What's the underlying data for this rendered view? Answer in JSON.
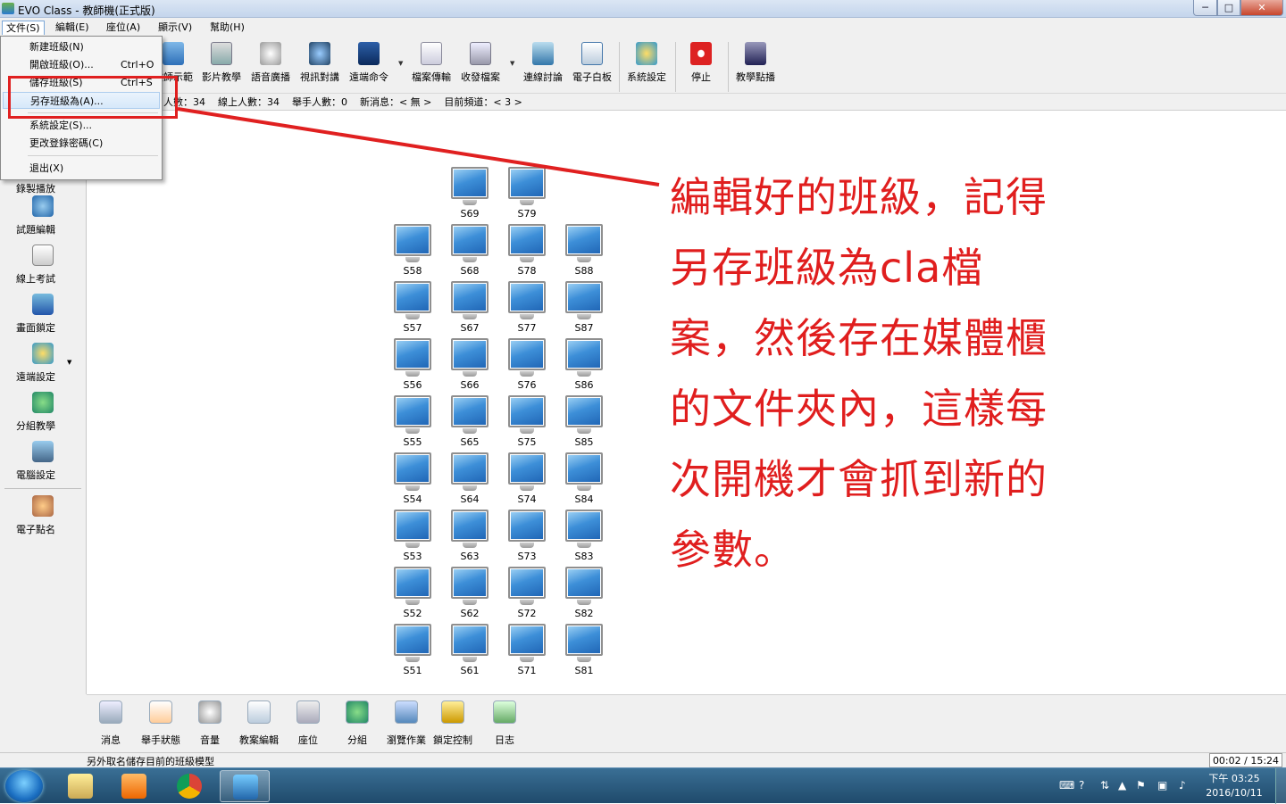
{
  "window": {
    "title": "EVO Class - 教師機(正式版)",
    "min_glyph": "─",
    "max_glyph": "□",
    "close_glyph": "✕"
  },
  "menubar": [
    {
      "label": "文件(S)"
    },
    {
      "label": "編輯(E)"
    },
    {
      "label": "座位(A)"
    },
    {
      "label": "顯示(V)"
    },
    {
      "label": "幫助(H)"
    }
  ],
  "file_menu": [
    {
      "label": "新建班級(N)",
      "shortcut": ""
    },
    {
      "label": "開啟班級(O)...",
      "shortcut": "Ctrl+O"
    },
    {
      "label": "儲存班級(S)",
      "shortcut": "Ctrl+S"
    },
    {
      "label": "另存班級為(A)...",
      "shortcut": ""
    },
    {
      "label": "系統設定(S)...",
      "shortcut": ""
    },
    {
      "label": "更改登錄密碼(C)",
      "shortcut": ""
    },
    {
      "label": "退出(X)",
      "shortcut": ""
    }
  ],
  "toolbar": [
    {
      "label": "教師示範",
      "icon": "monitor-icon"
    },
    {
      "label": "影片教學",
      "icon": "film-icon"
    },
    {
      "label": "語音廣播",
      "icon": "speaker-icon"
    },
    {
      "label": "視訊對講",
      "icon": "webcam-icon"
    },
    {
      "label": "遠端命令",
      "icon": "terminal-icon"
    },
    {
      "label": "檔案傳輸",
      "icon": "file-transfer-icon"
    },
    {
      "label": "收發檔案",
      "icon": "folder-icon"
    },
    {
      "label": "連線討論",
      "icon": "discussion-icon"
    },
    {
      "label": "電子白板",
      "icon": "whiteboard-icon"
    },
    {
      "label": "系統設定",
      "icon": "settings-icon"
    },
    {
      "label": "停止",
      "icon": "stop-icon"
    },
    {
      "label": "教學點播",
      "icon": "vod-icon"
    }
  ],
  "infobar": {
    "text": "人數：34    線上人數：34    舉手人數：0    新消息：< 無 >    目前頻道：< 3 >"
  },
  "sidebar": [
    {
      "label": "錄製播放",
      "icon": "record-icon"
    },
    {
      "label": "試題編輯",
      "icon": "question-icon"
    },
    {
      "label": "線上考試",
      "icon": "exam-icon"
    },
    {
      "label": "畫面鎖定",
      "icon": "lock-screen-icon"
    },
    {
      "label": "遠端設定",
      "icon": "remote-settings-icon"
    },
    {
      "label": "分組教學",
      "icon": "group-icon"
    },
    {
      "label": "電腦設定",
      "icon": "computer-settings-icon"
    },
    {
      "label": "電子點名",
      "icon": "rollcall-icon"
    }
  ],
  "seats": [
    {
      "label": "S69"
    },
    {
      "label": "S79"
    },
    {
      "label": "S58"
    },
    {
      "label": "S68"
    },
    {
      "label": "S78"
    },
    {
      "label": "S88"
    },
    {
      "label": "S57"
    },
    {
      "label": "S67"
    },
    {
      "label": "S77"
    },
    {
      "label": "S87"
    },
    {
      "label": "S56"
    },
    {
      "label": "S66"
    },
    {
      "label": "S76"
    },
    {
      "label": "S86"
    },
    {
      "label": "S55"
    },
    {
      "label": "S65"
    },
    {
      "label": "S75"
    },
    {
      "label": "S85"
    },
    {
      "label": "S54"
    },
    {
      "label": "S64"
    },
    {
      "label": "S74"
    },
    {
      "label": "S84"
    },
    {
      "label": "S53"
    },
    {
      "label": "S63"
    },
    {
      "label": "S73"
    },
    {
      "label": "S83"
    },
    {
      "label": "S52"
    },
    {
      "label": "S62"
    },
    {
      "label": "S72"
    },
    {
      "label": "S82"
    },
    {
      "label": "S51"
    },
    {
      "label": "S61"
    },
    {
      "label": "S71"
    },
    {
      "label": "S81"
    }
  ],
  "bottombar": [
    {
      "label": "消息",
      "icon": "message-icon"
    },
    {
      "label": "舉手狀態",
      "icon": "raise-hand-icon"
    },
    {
      "label": "音量",
      "icon": "volume-icon"
    },
    {
      "label": "教案編輯",
      "icon": "lesson-edit-icon"
    },
    {
      "label": "座位",
      "icon": "seat-icon"
    },
    {
      "label": "分組",
      "icon": "group-icon"
    },
    {
      "label": "瀏覽作業",
      "icon": "browse-homework-icon"
    },
    {
      "label": "鎖定控制",
      "icon": "lock-icon"
    },
    {
      "label": "日志",
      "icon": "log-icon"
    }
  ],
  "statusbar": {
    "text": "另外取名儲存目前的班級模型",
    "time": "00:02 / 15:24"
  },
  "annotation": {
    "lines": [
      "編輯好的班級，記得",
      "另存班級為cla檔",
      "案，然後存在媒體櫃",
      "的文件夾內，這樣每",
      "次開機才會抓到新的",
      "參數。"
    ],
    "color": "#e01e1e"
  },
  "taskbar": {
    "apps": [
      {
        "icon": "explorer-icon"
      },
      {
        "icon": "media-player-icon"
      },
      {
        "icon": "chrome-icon"
      },
      {
        "icon": "evo-class-icon"
      }
    ],
    "clock_period_time": "下午 03:25",
    "clock_date": "2016/10/11"
  }
}
